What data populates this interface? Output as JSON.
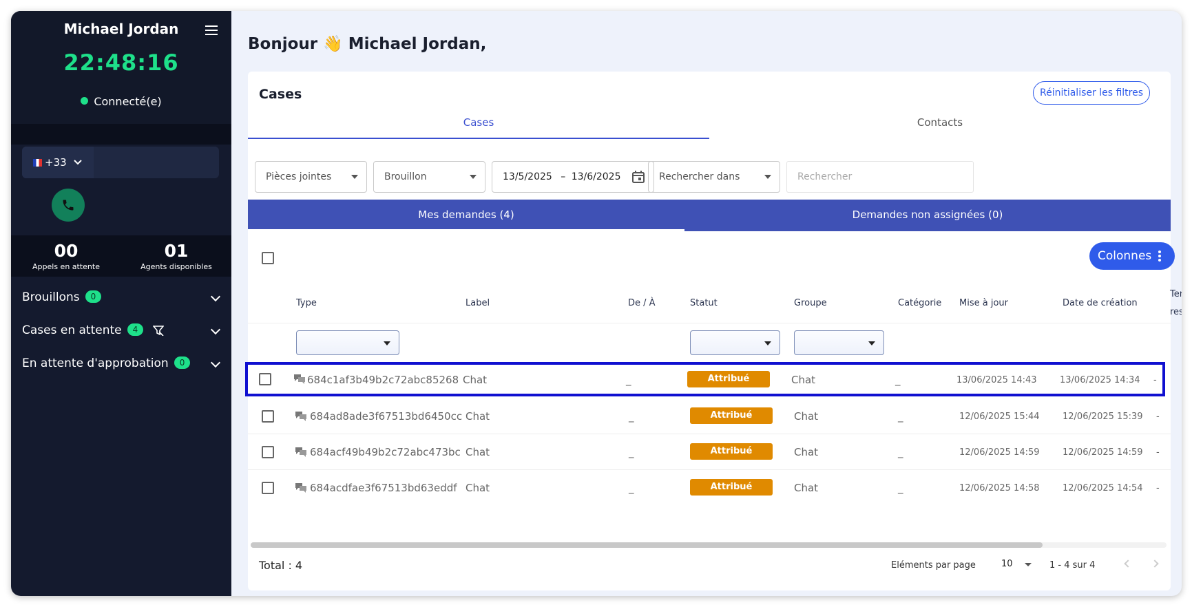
{
  "sidebar": {
    "agent_name": "Michael Jordan",
    "clock": "22:48:16",
    "status": "Connecté(e)",
    "country_code": "+33",
    "phone_placeholder": "",
    "stats": [
      {
        "value": "00",
        "label": "Appels en attente"
      },
      {
        "value": "01",
        "label": "Agents disponibles"
      }
    ],
    "sections": [
      {
        "label": "Brouillons",
        "count": "0"
      },
      {
        "label": "Cases en attente",
        "count": "4"
      },
      {
        "label": "En attente d'approbation",
        "count": "0"
      }
    ],
    "colors": {
      "bg": "#141a2e",
      "accent": "#1ee08a",
      "call": "#12805a"
    }
  },
  "main": {
    "greeting": "Bonjour 👋 Michael Jordan,",
    "card_title": "Cases",
    "reset_label": "Réinitialiser les filtres",
    "tabs": [
      {
        "label": "Cases",
        "active": true
      },
      {
        "label": "Contacts",
        "active": false
      }
    ],
    "filters": {
      "attachments": "Pièces jointes",
      "draft": "Brouillon",
      "date_from": "13/5/2025",
      "date_sep": "–",
      "date_to": "13/6/2025",
      "search_in": "Rechercher dans",
      "search_placeholder": "Rechercher"
    },
    "subtabs": [
      {
        "label": "Mes demandes (4)",
        "active": true
      },
      {
        "label": "Demandes non assignées (0)",
        "active": false
      }
    ],
    "columns_button": "Colonnes",
    "table": {
      "headers": [
        "Type",
        "Label",
        "De / À",
        "Statut",
        "Groupe",
        "Catégorie",
        "Mise à jour",
        "Date de création",
        "Ter",
        "res"
      ],
      "rows": [
        {
          "id": "684c1af3b49b2c72abc85268",
          "label": "Chat",
          "from": "_",
          "status": "Attribué",
          "group": "Chat",
          "category": "_",
          "updated": "13/06/2025 14:43",
          "created": "13/06/2025 14:34",
          "extra": "-"
        },
        {
          "id": "684ad8ade3f67513bd6450cc",
          "label": "Chat",
          "from": "_",
          "status": "Attribué",
          "group": "Chat",
          "category": "_",
          "updated": "12/06/2025 15:44",
          "created": "12/06/2025 15:39",
          "extra": "-"
        },
        {
          "id": "684acf49b49b2c72abc473bc",
          "label": "Chat",
          "from": "_",
          "status": "Attribué",
          "group": "Chat",
          "category": "_",
          "updated": "12/06/2025 14:59",
          "created": "12/06/2025 14:59",
          "extra": "-"
        },
        {
          "id": "684acdfae3f67513bd63eddf",
          "label": "Chat",
          "from": "_",
          "status": "Attribué",
          "group": "Chat",
          "category": "_",
          "updated": "12/06/2025 14:58",
          "created": "12/06/2025 14:54",
          "extra": "-"
        }
      ]
    },
    "footer": {
      "total": "Total : 4",
      "per_page_label": "Eléments par page",
      "per_page_value": "10",
      "range": "1 - 4 sur 4"
    },
    "colors": {
      "primary": "#2f5bea",
      "subtab_bg": "#3f51b5",
      "status": "#e08a00",
      "highlight": "#1010d0"
    }
  }
}
